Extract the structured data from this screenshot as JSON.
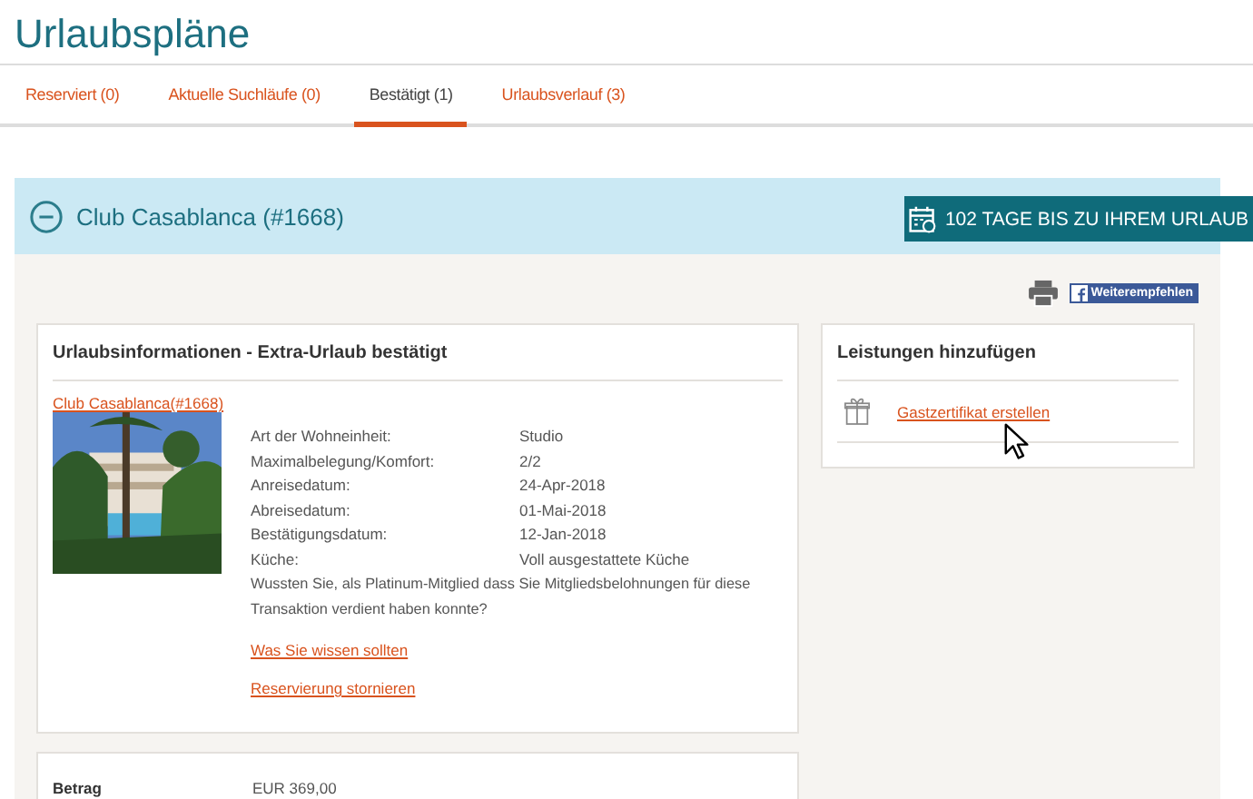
{
  "page_title": "Urlaubspläne",
  "tabs": [
    {
      "label": "Reserviert (0)",
      "selected": false
    },
    {
      "label": "Aktuelle Suchläufe (0)",
      "selected": false
    },
    {
      "label": "Bestätigt (1)",
      "selected": true
    },
    {
      "label": "Urlaubsverlauf (3)",
      "selected": false
    }
  ],
  "booking": {
    "title": "Club Casablanca (#1668)",
    "expanded": true,
    "countdown": "102 TAGE BIS ZU IHREM URLAUB",
    "share_button": "Weiterempfehlen",
    "info": {
      "heading": "Urlaubsinformationen - Extra-Urlaub bestätigt",
      "resort_link": "Club Casablanca(#1668)",
      "details": [
        {
          "label": "Art der Wohneinheit:",
          "value": "Studio"
        },
        {
          "label": "Maximalbelegung/Komfort:",
          "value": "2/2"
        },
        {
          "label": "Anreisedatum:",
          "value": "24-Apr-2018"
        },
        {
          "label": "Abreisedatum:",
          "value": "01-Mai-2018"
        },
        {
          "label": "Bestätigungsdatum:",
          "value": "12-Jan-2018"
        },
        {
          "label": "Küche:",
          "value": "Voll ausgestattete Küche"
        }
      ],
      "note": "Wussten Sie, als Platinum-Mitglied dass Sie Mitgliedsbelohnungen für diese Transaktion verdient haben konnte?",
      "links": [
        "Was Sie wissen sollten",
        "Reservierung stornieren"
      ]
    },
    "services": {
      "heading": "Leistungen hinzufügen",
      "link": "Gastzertifikat erstellen"
    },
    "payment": {
      "label": "Betrag",
      "value": "EUR 369,00"
    }
  }
}
